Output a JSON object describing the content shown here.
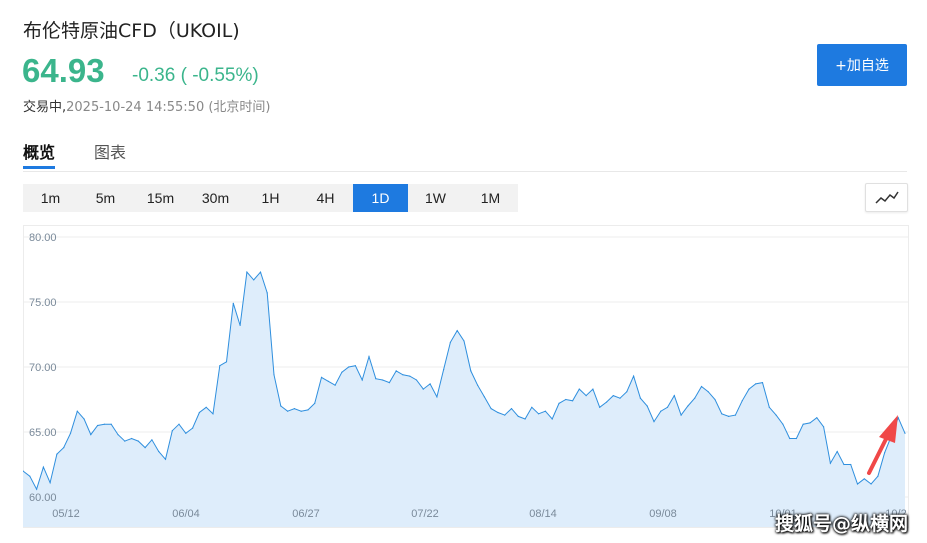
{
  "header": {
    "title": "布伦特原油CFD（UKOIL)",
    "price": "64.93",
    "change": "-0.36 ( -0.55%)",
    "status": "交易中,",
    "timestamp": "2025-10-24 14:55:50 (北京时间)",
    "add_label": "+加自选"
  },
  "tabs": [
    {
      "label": "概览",
      "active": true
    },
    {
      "label": "图表",
      "active": false
    }
  ],
  "periods": [
    {
      "label": "1m",
      "active": false
    },
    {
      "label": "5m",
      "active": false
    },
    {
      "label": "15m",
      "active": false
    },
    {
      "label": "30m",
      "active": false
    },
    {
      "label": "1H",
      "active": false
    },
    {
      "label": "4H",
      "active": false
    },
    {
      "label": "1D",
      "active": true
    },
    {
      "label": "1W",
      "active": false
    },
    {
      "label": "1M",
      "active": false
    }
  ],
  "chart_type_icon": "line-chart-icon",
  "colors": {
    "up_green": "#3bb58c",
    "accent_blue": "#1e7ae0",
    "line": "#2f8fde",
    "area": "#deedfb",
    "arrow": "#f04848"
  },
  "chart_data": {
    "type": "area",
    "title": "",
    "xlabel": "",
    "ylabel": "",
    "ylim": [
      60,
      80.5
    ],
    "yticks": [
      "60.00",
      "65.00",
      "70.00",
      "75.00",
      "80.00"
    ],
    "xtick_labels": [
      "05/12",
      "06/04",
      "06/27",
      "07/22",
      "08/14",
      "09/08",
      "10/01",
      "10/2"
    ],
    "grid": true,
    "annotation": "red arrow pointing to latest price",
    "values": [
      62.0,
      61.6,
      60.6,
      62.3,
      61.1,
      63.3,
      63.8,
      64.9,
      66.6,
      66.0,
      64.8,
      65.5,
      65.6,
      65.6,
      64.8,
      64.3,
      64.5,
      64.3,
      63.8,
      64.4,
      63.5,
      62.9,
      65.1,
      65.6,
      64.9,
      65.3,
      66.5,
      66.9,
      66.4,
      70.1,
      70.4,
      74.9,
      73.2,
      77.3,
      76.7,
      77.3,
      75.7,
      69.4,
      67.0,
      66.6,
      66.8,
      66.6,
      66.7,
      67.2,
      69.2,
      68.9,
      68.6,
      69.6,
      70.0,
      70.1,
      69.0,
      70.8,
      69.1,
      69.0,
      68.8,
      69.7,
      69.4,
      69.3,
      69.0,
      68.3,
      68.7,
      67.7,
      69.8,
      71.9,
      72.8,
      72.0,
      69.7,
      68.6,
      67.7,
      66.8,
      66.5,
      66.3,
      66.8,
      66.2,
      66.0,
      66.9,
      66.4,
      66.6,
      66.0,
      67.2,
      67.5,
      67.4,
      68.3,
      67.8,
      68.3,
      66.9,
      67.3,
      67.8,
      67.6,
      68.1,
      69.3,
      67.6,
      67.0,
      65.8,
      66.6,
      66.9,
      67.8,
      66.3,
      67.0,
      67.6,
      68.5,
      68.1,
      67.5,
      66.4,
      66.2,
      66.3,
      67.4,
      68.3,
      68.7,
      68.8,
      66.9,
      66.3,
      65.6,
      64.5,
      64.5,
      65.6,
      65.7,
      66.1,
      65.4,
      62.6,
      63.5,
      62.5,
      62.5,
      61.0,
      61.4,
      61.0,
      61.6,
      63.4,
      64.7,
      66.1,
      64.9
    ]
  },
  "watermark": "搜狐号@纵横网"
}
